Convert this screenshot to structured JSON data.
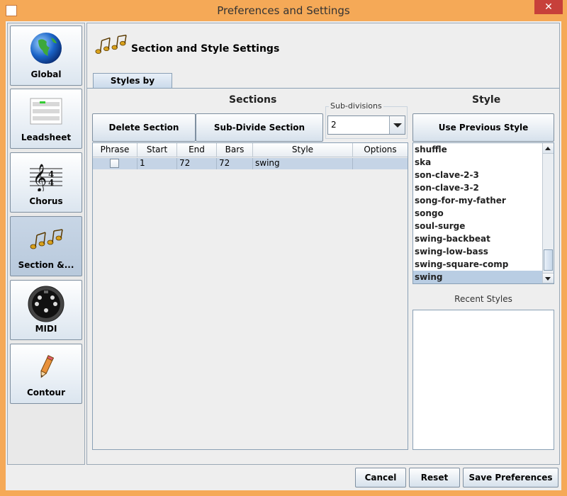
{
  "window": {
    "title": "Preferences and Settings",
    "close_glyph": "✕"
  },
  "nav": [
    {
      "label": "Global",
      "icon": "globe-icon"
    },
    {
      "label": "Leadsheet",
      "icon": "leadsheet-icon"
    },
    {
      "label": "Chorus",
      "icon": "treble-clef-icon"
    },
    {
      "label": "Section &...",
      "icon": "music-notes-icon"
    },
    {
      "label": "MIDI",
      "icon": "midi-connector-icon"
    },
    {
      "label": "Contour",
      "icon": "pencil-icon"
    }
  ],
  "header": {
    "title": "Section and Style Settings",
    "icon": "music-notes-icon"
  },
  "tabs": [
    {
      "label": "Styles by Section",
      "selected": true
    }
  ],
  "sections": {
    "heading": "Sections",
    "delete_button": "Delete Section",
    "subdivide_button": "Sub-Divide Section",
    "subdivisions": {
      "label": "Sub-divisions",
      "value": "2"
    },
    "table": {
      "columns": [
        "Phrase",
        "Start",
        "End",
        "Bars",
        "Style",
        "Options"
      ],
      "rows": [
        {
          "phrase": false,
          "start": "1",
          "end": "72",
          "bars": "72",
          "style": "swing",
          "options": ""
        }
      ]
    }
  },
  "style": {
    "heading": "Style",
    "use_previous_button": "Use Previous Style",
    "items": [
      "shuffle",
      "ska",
      "son-clave-2-3",
      "son-clave-3-2",
      "song-for-my-father",
      "songo",
      "soul-surge",
      "swing-backbeat",
      "swing-low-bass",
      "swing-square-comp",
      "swing"
    ],
    "selected": "swing",
    "recent_label": "Recent Styles"
  },
  "footer": {
    "cancel": "Cancel",
    "reset": "Reset",
    "save": "Save Preferences"
  },
  "colors": {
    "accent_frame": "#f5a957",
    "selection": "#b9cde3"
  }
}
